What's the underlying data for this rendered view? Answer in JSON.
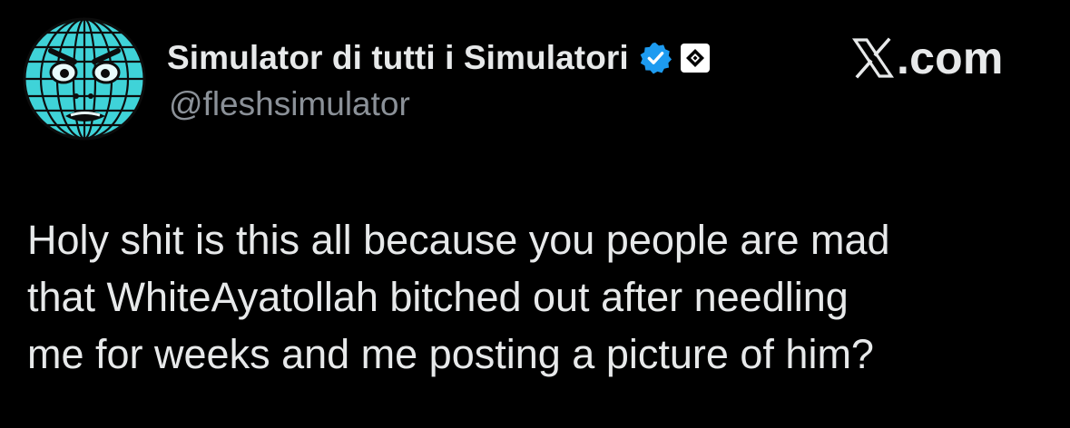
{
  "author": {
    "display_name": "Simulator di tutti i Simulatori",
    "handle": "@fleshsimulator",
    "avatar_icon": "wireframe-globe-face-avatar",
    "avatar_color": "#3fd3d8",
    "verified_icon": "verified-badge-icon",
    "verified_color": "#1d9bf0",
    "affiliate_icon": "affiliate-badge-icon"
  },
  "brand": {
    "icon": "x-logo-icon",
    "text": ".com"
  },
  "tweet": {
    "lines": [
      "Holy shit is this all because you people are mad",
      "that WhiteAyatollah bitched out after needling",
      "me for weeks and me posting a picture of him?"
    ]
  },
  "colors": {
    "background": "#000000",
    "text": "#e7e9ea",
    "secondary_text": "#8b9198"
  }
}
